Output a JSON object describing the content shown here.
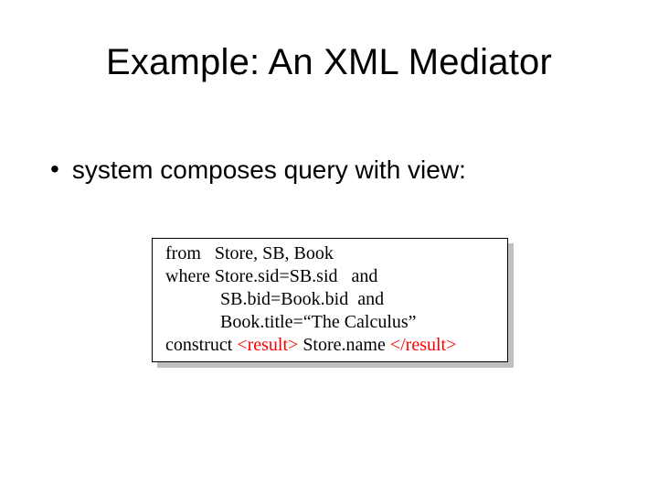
{
  "title": "Example: An XML Mediator",
  "bullet": "system composes query with view:",
  "code": {
    "l1": "from   Store, SB, Book",
    "l2": "where Store.sid=SB.sid   and",
    "l3": "            SB.bid=Book.bid  and",
    "l4": "            Book.title=“The Calculus”",
    "l5a": "construct ",
    "l5b": "<result>",
    "l5c": " Store.name ",
    "l5d": "</result>"
  }
}
